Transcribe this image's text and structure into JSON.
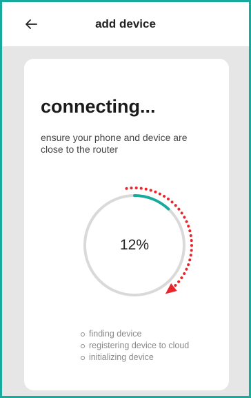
{
  "header": {
    "title": "add device",
    "back_icon": "arrow-left-icon"
  },
  "card": {
    "title": "connecting...",
    "subtitle": "ensure your phone and device are close to the router"
  },
  "progress": {
    "value": 12,
    "label": "12%",
    "track_color": "#d9d9d9",
    "fill_color": "#17ab9e",
    "annotation_color": "#e8262b"
  },
  "steps": [
    {
      "label": "finding device"
    },
    {
      "label": "registering device to cloud"
    },
    {
      "label": "initializing device"
    }
  ],
  "colors": {
    "accent": "#17ab9e",
    "background": "#e6e6e6",
    "card": "#ffffff"
  }
}
